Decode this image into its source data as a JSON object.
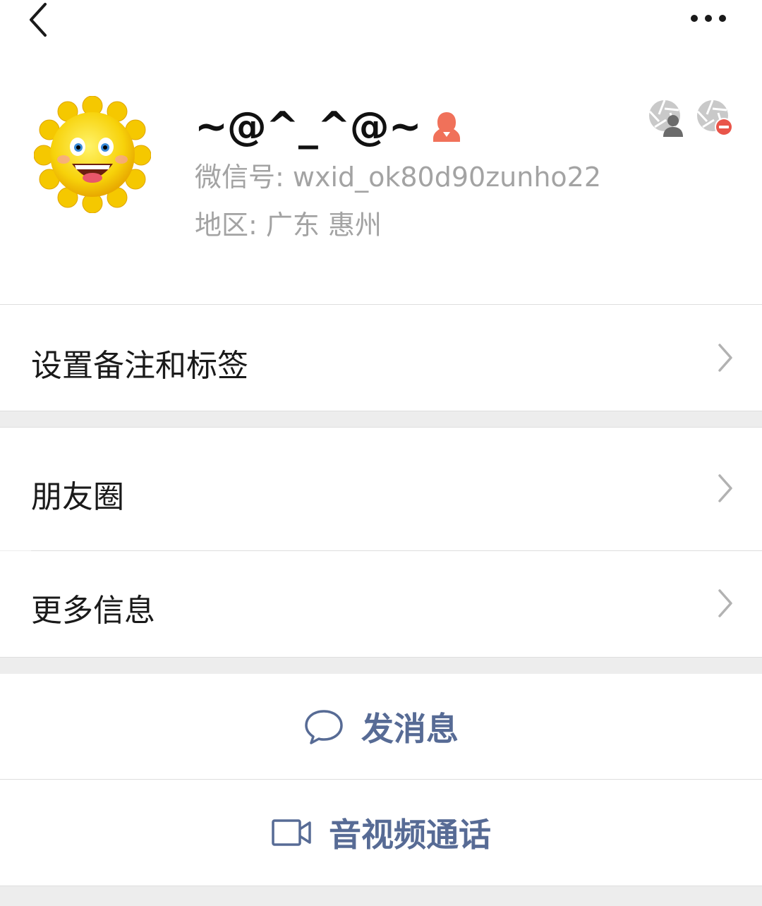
{
  "header": {
    "back_icon": "chevron-left-icon",
    "more_icon": "more-dots-icon"
  },
  "profile": {
    "nickname": "~@^_^@~",
    "gender_icon": "female-user-icon",
    "wechat_id": "微信号: wxid_ok80d90zunho22",
    "region": "地区: 广东  惠州",
    "top_icons": [
      "moments-visibility-person-icon",
      "moments-visibility-blocked-icon"
    ]
  },
  "rows": {
    "remark_label": "设置备注和标签",
    "moments_label": "朋友圈",
    "more_info_label": "更多信息"
  },
  "actions": {
    "message_label": "发消息",
    "video_call_label": "音视频通话"
  },
  "colors": {
    "link_blue": "#576b95",
    "background": "#ededed",
    "gender_orange": "#f0715a"
  }
}
